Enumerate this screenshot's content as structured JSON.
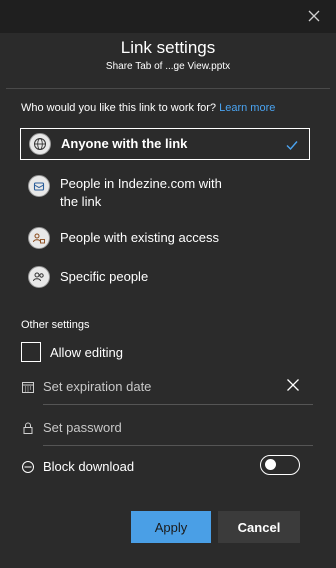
{
  "dialog": {
    "title": "Link settings",
    "subtitle": "Share Tab of ...ge View.pptx"
  },
  "audience": {
    "question": "Who would you like this link to work for?",
    "learn_more": "Learn more",
    "options": [
      {
        "label": "Anyone with the link",
        "icon": "globe-icon",
        "selected": true
      },
      {
        "label_line1": "People in Indezine.com with",
        "label_line2": "the link",
        "icon": "organization-icon",
        "selected": false
      },
      {
        "label": "People with existing access",
        "icon": "people-lock-icon",
        "selected": false
      },
      {
        "label": "Specific people",
        "icon": "people-icon",
        "selected": false
      }
    ]
  },
  "other_settings": {
    "label": "Other settings",
    "allow_editing": {
      "label": "Allow editing",
      "checked": false
    },
    "expiration": {
      "placeholder": "Set expiration date"
    },
    "password": {
      "placeholder": "Set password"
    },
    "block_download": {
      "label": "Block download",
      "enabled": false
    }
  },
  "buttons": {
    "apply": "Apply",
    "cancel": "Cancel"
  },
  "colors": {
    "accent": "#4a9fe6",
    "background": "#2b2b2b",
    "link": "#4aa3f0"
  }
}
